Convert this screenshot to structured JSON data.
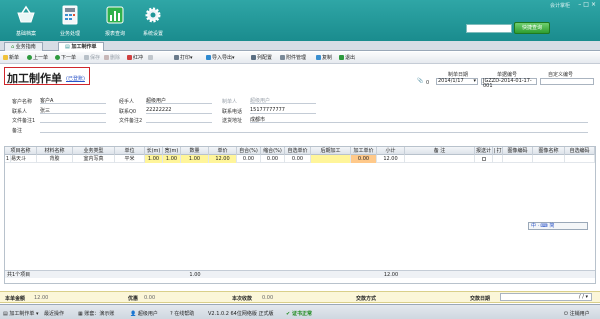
{
  "topbar": {
    "nav": [
      {
        "label": "基础档案",
        "icon": "basket-icon"
      },
      {
        "label": "业务处理",
        "icon": "calculator-icon"
      },
      {
        "label": "报表查询",
        "icon": "bar-chart-icon"
      },
      {
        "label": "系统设置",
        "icon": "gear-icon"
      }
    ],
    "brand": "会计掌柜",
    "search_button": "快捷查询"
  },
  "tabs": [
    {
      "label": "业务指南",
      "active": false
    },
    {
      "label": "加工制作单",
      "active": true
    }
  ],
  "toolbar": [
    {
      "label": "新单",
      "enabled": true
    },
    {
      "label": "上一单",
      "enabled": true
    },
    {
      "label": "下一单",
      "enabled": true
    },
    {
      "label": "保存",
      "enabled": false
    },
    {
      "label": "删除",
      "enabled": false
    },
    {
      "label": "红冲",
      "enabled": true
    },
    {
      "label": "打印",
      "enabled": true
    },
    {
      "label": "导入导出",
      "enabled": true
    },
    {
      "label": "列配置",
      "enabled": true
    },
    {
      "label": "附件管理",
      "enabled": true
    },
    {
      "label": "复制",
      "enabled": true
    },
    {
      "label": "退出",
      "enabled": true
    }
  ],
  "document": {
    "title": "加工制作单",
    "status_link": "(已登账)",
    "attachment_count": "0",
    "date_label": "制单日期",
    "date_value": "2014/1/17",
    "number_label": "单据编号",
    "number_value": "JGZZD-2014-01-17-001",
    "custom_no_label": "自定义编号",
    "custom_no_value": ""
  },
  "form": {
    "customer_label": "客户名称",
    "customer_value": "客户A",
    "contact_label": "联系人",
    "contact_value": "张三",
    "file_note1_label": "文件备注1",
    "file_note1_value": "",
    "remark_label": "备注",
    "remark_value": "",
    "handler_label": "经手人",
    "handler_value": "超级用户",
    "phone_label": "联系Q0",
    "phone_value": "22222222",
    "file_note2_label": "文件备注2",
    "file_note2_value": "",
    "maker_label": "制单人",
    "maker_value": "超级用户",
    "tel_label": "联系电话",
    "tel_value": "15177777777",
    "address_label": "送货地址",
    "address_value": "成都市"
  },
  "grid": {
    "headers": [
      "项目名称",
      "材料名称",
      "业务类型",
      "单位",
      "长(m)",
      "宽(m)",
      "数量",
      "单价",
      "自合(%)",
      "缩合(%)",
      "自选单价",
      "后期加工",
      "加工单价",
      "小计",
      "备 注",
      "报送计",
      "| 打",
      "图像编码",
      "图像名称",
      "自选编码"
    ],
    "rows": [
      [
        "1",
        "易天斗",
        "背胶",
        "室内写真",
        "平米",
        "1.00",
        "1.00",
        "1.00",
        "12.00",
        "0.00",
        "0.00",
        "0.00",
        "",
        "0.00",
        "12.00",
        "",
        "",
        "",
        "",
        ""
      ]
    ],
    "footer_count": "共1个项目",
    "footer_qty": "1.00",
    "footer_total": "12.00"
  },
  "ime": "中 ⸱ ⌨ 简",
  "totals": {
    "amount_label": "本单金额",
    "amount_value": "12.00",
    "discount_label": "优惠",
    "discount_value": "0.00",
    "received_label": "本次收款",
    "received_value": "0.00",
    "method_label": "交款方式",
    "method_value": "",
    "date_label": "交款日期",
    "date_value": "/ /"
  },
  "statusbar": {
    "module": "加工制作单",
    "recent": "最近操作",
    "account": "账套：演示账",
    "user": "超级用户",
    "help": "在线帮助",
    "version": "V2.1.0.2 64位网络版 正式版",
    "cert": "证书正常",
    "logout": "注销用户"
  },
  "colors": {
    "banner": "#1f9698",
    "highlight_yellow": "#fff59a",
    "highlight_orange": "#ffc98a",
    "title_border": "#d0262b"
  }
}
